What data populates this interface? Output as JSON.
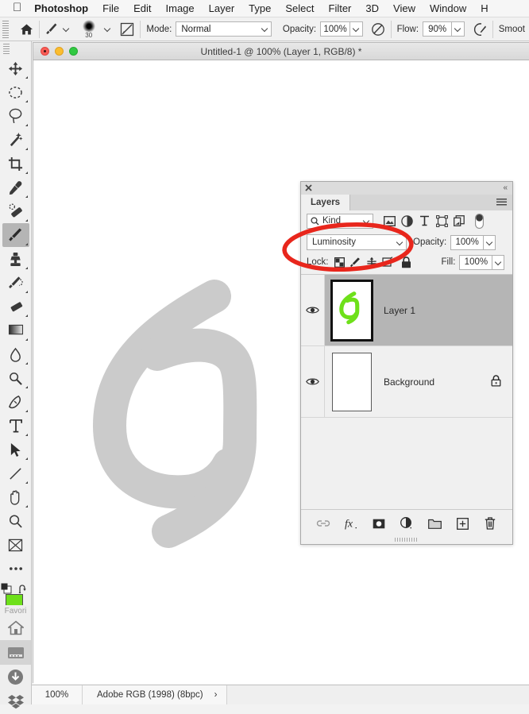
{
  "menubar": {
    "apple_icon": "apple-icon",
    "items": [
      {
        "label": "Photoshop",
        "bold": true
      },
      {
        "label": "File",
        "bold": false
      },
      {
        "label": "Edit",
        "bold": false
      },
      {
        "label": "Image",
        "bold": false
      },
      {
        "label": "Layer",
        "bold": false
      },
      {
        "label": "Type",
        "bold": false
      },
      {
        "label": "Select",
        "bold": false
      },
      {
        "label": "Filter",
        "bold": false
      },
      {
        "label": "3D",
        "bold": false
      },
      {
        "label": "View",
        "bold": false
      },
      {
        "label": "Window",
        "bold": false
      },
      {
        "label": "H",
        "bold": false
      }
    ]
  },
  "options_bar": {
    "home_icon": "home-icon",
    "brush_preset_icon": "brush-icon",
    "brush_size": "30",
    "toggle_brush_panel_icon": "brush-panel-icon",
    "mode_label": "Mode:",
    "mode_value": "Normal",
    "opacity_label": "Opacity:",
    "opacity_value": "100%",
    "opacity_pressure_icon": "pressure-opacity-icon",
    "flow_label": "Flow:",
    "flow_value": "90%",
    "airbrush_icon": "airbrush-icon",
    "smoothing_label": "Smoot"
  },
  "toolbar": {
    "tools": [
      {
        "name": "move-tool",
        "selected": false,
        "has_submenu": true
      },
      {
        "name": "marquee-tool",
        "selected": false,
        "has_submenu": true
      },
      {
        "name": "lasso-tool",
        "selected": false,
        "has_submenu": true
      },
      {
        "name": "quick-selection-tool",
        "selected": false,
        "has_submenu": true
      },
      {
        "name": "crop-tool",
        "selected": false,
        "has_submenu": true
      },
      {
        "name": "eyedropper-tool",
        "selected": false,
        "has_submenu": true
      },
      {
        "name": "spot-healing-brush-tool",
        "selected": false,
        "has_submenu": true
      },
      {
        "name": "brush-tool",
        "selected": true,
        "has_submenu": true
      },
      {
        "name": "clone-stamp-tool",
        "selected": false,
        "has_submenu": true
      },
      {
        "name": "history-brush-tool",
        "selected": false,
        "has_submenu": true
      },
      {
        "name": "eraser-tool",
        "selected": false,
        "has_submenu": true
      },
      {
        "name": "gradient-tool",
        "selected": false,
        "has_submenu": true
      },
      {
        "name": "blur-tool",
        "selected": false,
        "has_submenu": true
      },
      {
        "name": "dodge-tool",
        "selected": false,
        "has_submenu": true
      },
      {
        "name": "pen-tool",
        "selected": false,
        "has_submenu": true
      },
      {
        "name": "type-tool",
        "selected": false,
        "has_submenu": true
      },
      {
        "name": "path-selection-tool",
        "selected": false,
        "has_submenu": true
      },
      {
        "name": "line-tool",
        "selected": false,
        "has_submenu": true
      },
      {
        "name": "hand-tool",
        "selected": false,
        "has_submenu": true
      },
      {
        "name": "zoom-tool",
        "selected": false,
        "has_submenu": false
      },
      {
        "name": "frame-tool",
        "selected": false,
        "has_submenu": false
      },
      {
        "name": "edit-toolbar-tool",
        "selected": false,
        "has_submenu": false
      }
    ],
    "foreground_color": "#6ee01a",
    "background_color": "#ffffff",
    "swap_colors_icon": "swap-colors-icon",
    "default_colors_icon": "default-colors-icon",
    "quick-mask-icon": "quick-mask-icon",
    "screen-mode-icon": "screen-mode-icon"
  },
  "dock": {
    "label": "Favori",
    "items": [
      {
        "name": "finder-home-icon",
        "active": false
      },
      {
        "name": "window-app-icon",
        "active": true
      },
      {
        "name": "downloads-icon",
        "active": false
      },
      {
        "name": "dropbox-icon",
        "active": false
      }
    ]
  },
  "document": {
    "title": "Untitled-1 @ 100% (Layer 1, RGB/8) *",
    "traffic_lights": [
      "close-button",
      "minimize-button",
      "zoom-button"
    ],
    "canvas_artwork": "gray-spiral-logo"
  },
  "status_bar": {
    "zoom": "100%",
    "color_profile": "Adobe RGB (1998) (8bpc)",
    "expand_arrow": "›"
  },
  "layers_panel": {
    "close_icon": "close-icon",
    "collapse_icon": "collapse-panel-icon",
    "tab_label": "Layers",
    "menu_icon": "panel-menu-icon",
    "filter": {
      "search_icon": "search-icon",
      "kind_label": "Kind",
      "chevron_icon": "chevron-down-icon",
      "type_filters": [
        "filter-pixel-icon",
        "filter-adjustment-icon",
        "filter-type-icon",
        "filter-shape-icon",
        "filter-smartobject-icon"
      ],
      "toggle_icon": "filter-toggle-switch"
    },
    "blend_mode": "Luminosity",
    "opacity_label": "Opacity:",
    "opacity_value": "100%",
    "lock_label": "Lock:",
    "lock_icons": [
      "lock-transparent-pixels-icon",
      "lock-image-pixels-icon",
      "lock-position-icon",
      "lock-artboard-nesting-icon",
      "lock-all-icon"
    ],
    "fill_label": "Fill:",
    "fill_value": "100%",
    "layers": [
      {
        "name": "Layer 1",
        "visible": true,
        "selected": true,
        "locked": false,
        "thumbnail": "green-spiral-logo"
      },
      {
        "name": "Background",
        "visible": true,
        "selected": false,
        "locked": true,
        "thumbnail": "white-blank"
      }
    ],
    "bottom_buttons": [
      "link-layers-icon",
      "layer-style-fx-icon",
      "add-layer-mask-icon",
      "new-adjustment-layer-icon",
      "new-group-icon",
      "new-layer-icon",
      "delete-layer-icon"
    ],
    "resize_grip": "resize-grip"
  },
  "annotation": {
    "shape": "red-ellipse-highlight",
    "color": "#e8261c",
    "target": "blend-mode-dropdown"
  }
}
